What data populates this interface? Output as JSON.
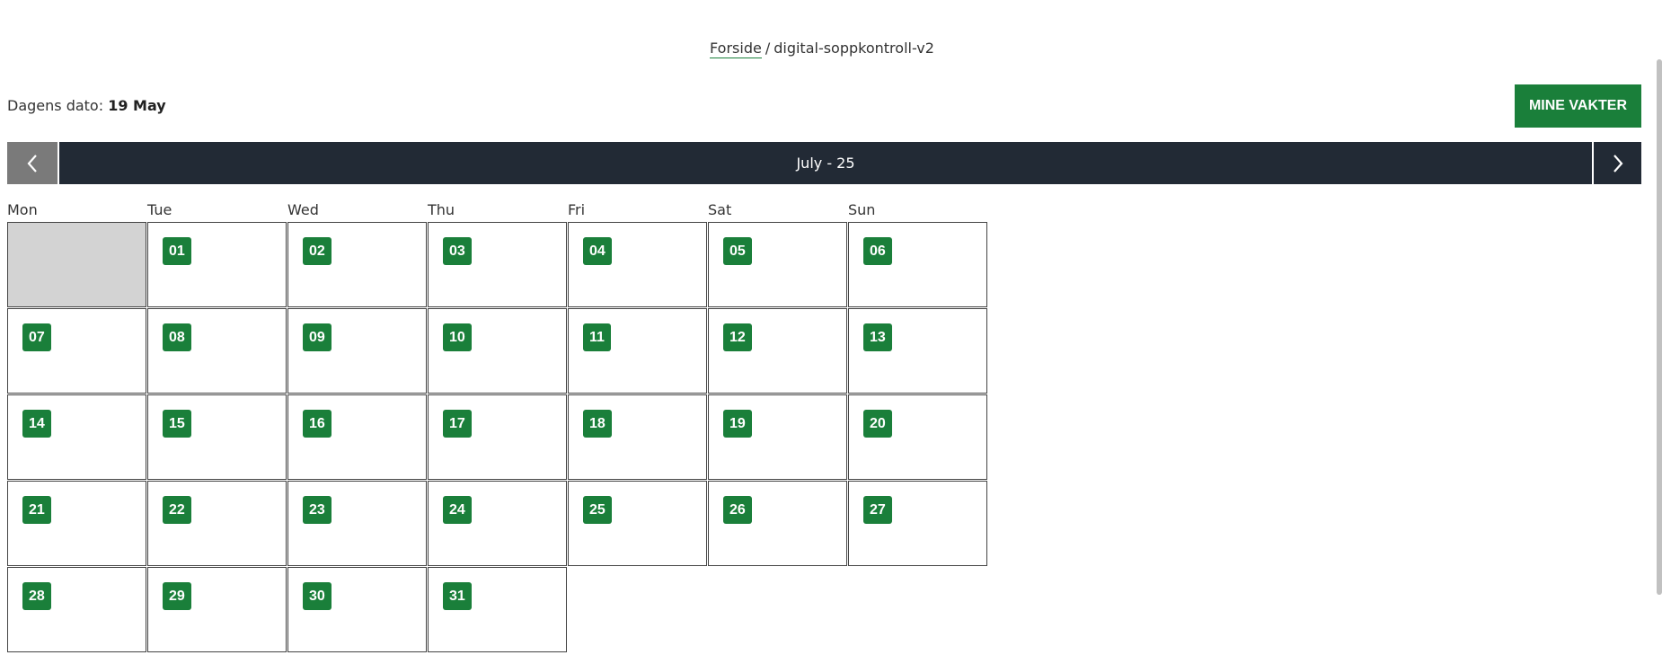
{
  "breadcrumb": {
    "home": "Forside",
    "separator": "/",
    "current": "digital-soppkontroll-v2"
  },
  "today": {
    "label": "Dagens dato:",
    "value": "19 May"
  },
  "header": {
    "mine_vakter": "MINE VAKTER"
  },
  "calendar": {
    "month_label": "July - 25",
    "weekdays": [
      "Mon",
      "Tue",
      "Wed",
      "Thu",
      "Fri",
      "Sat",
      "Sun"
    ],
    "leading_empty_days": 1,
    "days": [
      "01",
      "02",
      "03",
      "04",
      "05",
      "06",
      "07",
      "08",
      "09",
      "10",
      "11",
      "12",
      "13",
      "14",
      "15",
      "16",
      "17",
      "18",
      "19",
      "20",
      "21",
      "22",
      "23",
      "24",
      "25",
      "26",
      "27",
      "28",
      "29",
      "30",
      "31"
    ]
  },
  "colors": {
    "accent": "#1a7f3a",
    "nav_dark": "#222a35",
    "nav_prev": "#7a7a7a",
    "empty_cell": "#d3d3d3"
  },
  "icons": {
    "prev": "chevron-left-icon",
    "next": "chevron-right-icon"
  }
}
